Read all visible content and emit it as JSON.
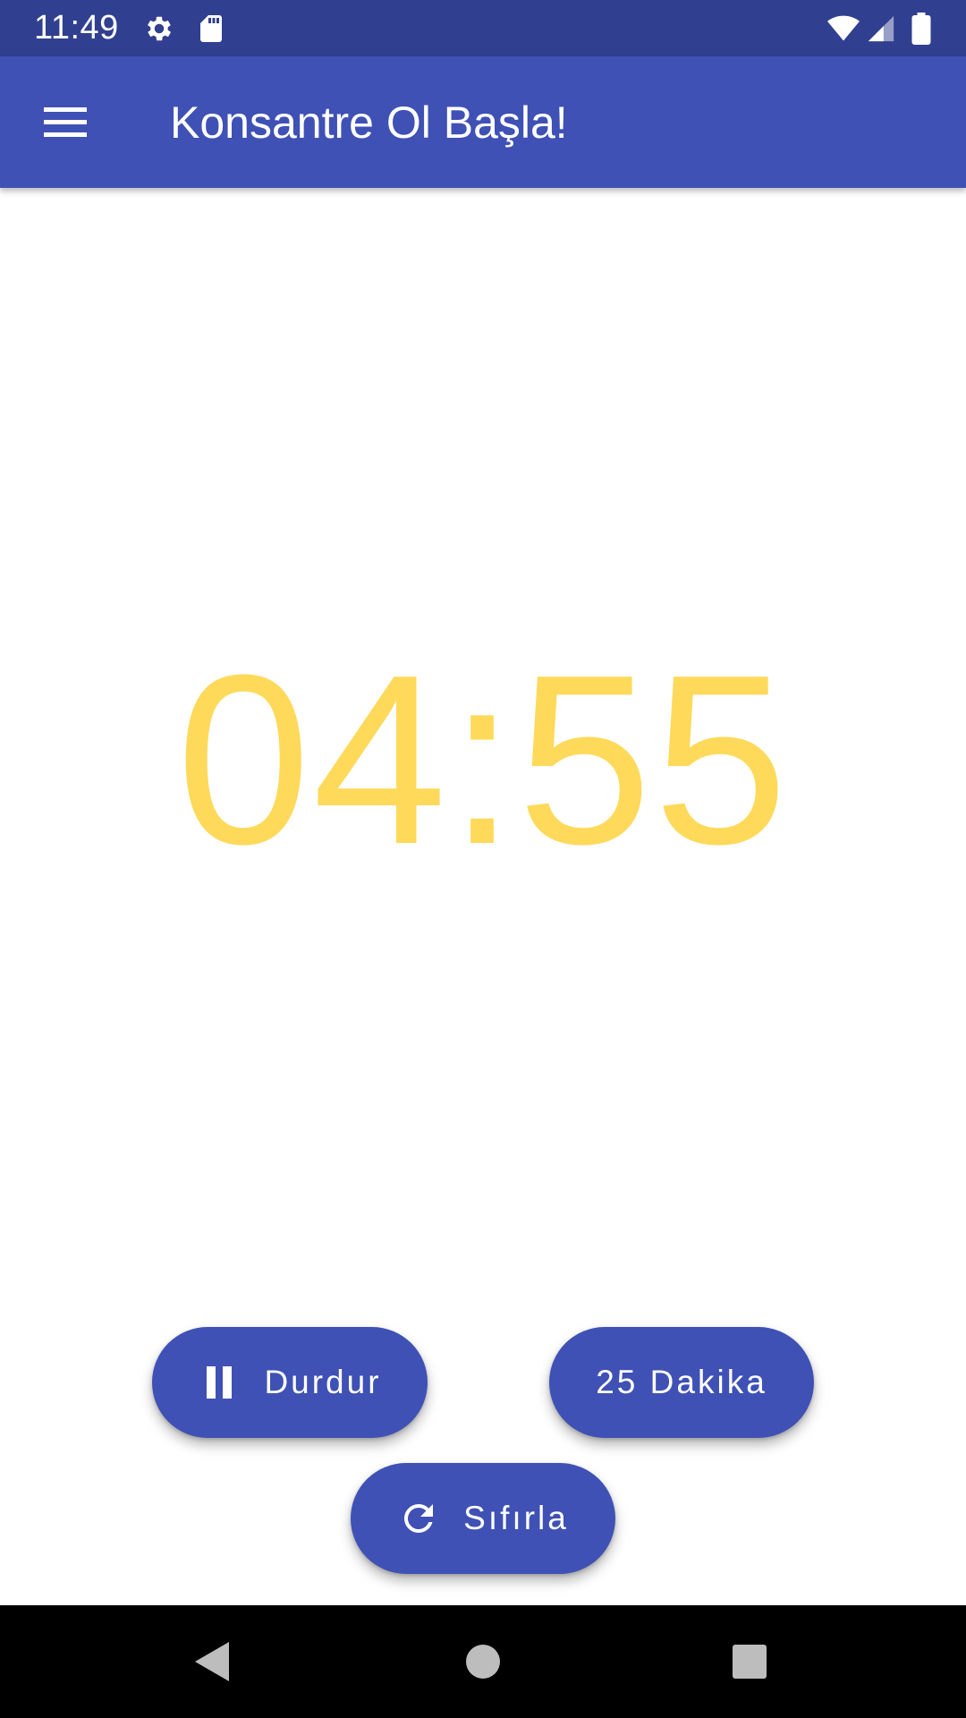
{
  "status_bar": {
    "time": "11:49",
    "icons": [
      "settings-icon",
      "sd-card-icon",
      "wifi-icon",
      "signal-icon",
      "battery-icon"
    ]
  },
  "app_bar": {
    "menu_icon": "hamburger-menu-icon",
    "title": "Konsantre Ol Başla!"
  },
  "timer": {
    "display": "04:55",
    "color": "#ffd95a"
  },
  "buttons": {
    "pause": {
      "label": "Durdur",
      "icon": "pause-icon"
    },
    "twenty_five": {
      "label": "25 Dakika"
    },
    "reset": {
      "label": "Sıfırla",
      "icon": "refresh-icon"
    }
  },
  "nav_bar": {
    "back_icon": "back-triangle-icon",
    "home_icon": "home-circle-icon",
    "recents_icon": "recents-square-icon"
  },
  "colors": {
    "primary": "#3f51b5",
    "primary_dark": "#303f8f",
    "accent_timer": "#ffd95a"
  }
}
